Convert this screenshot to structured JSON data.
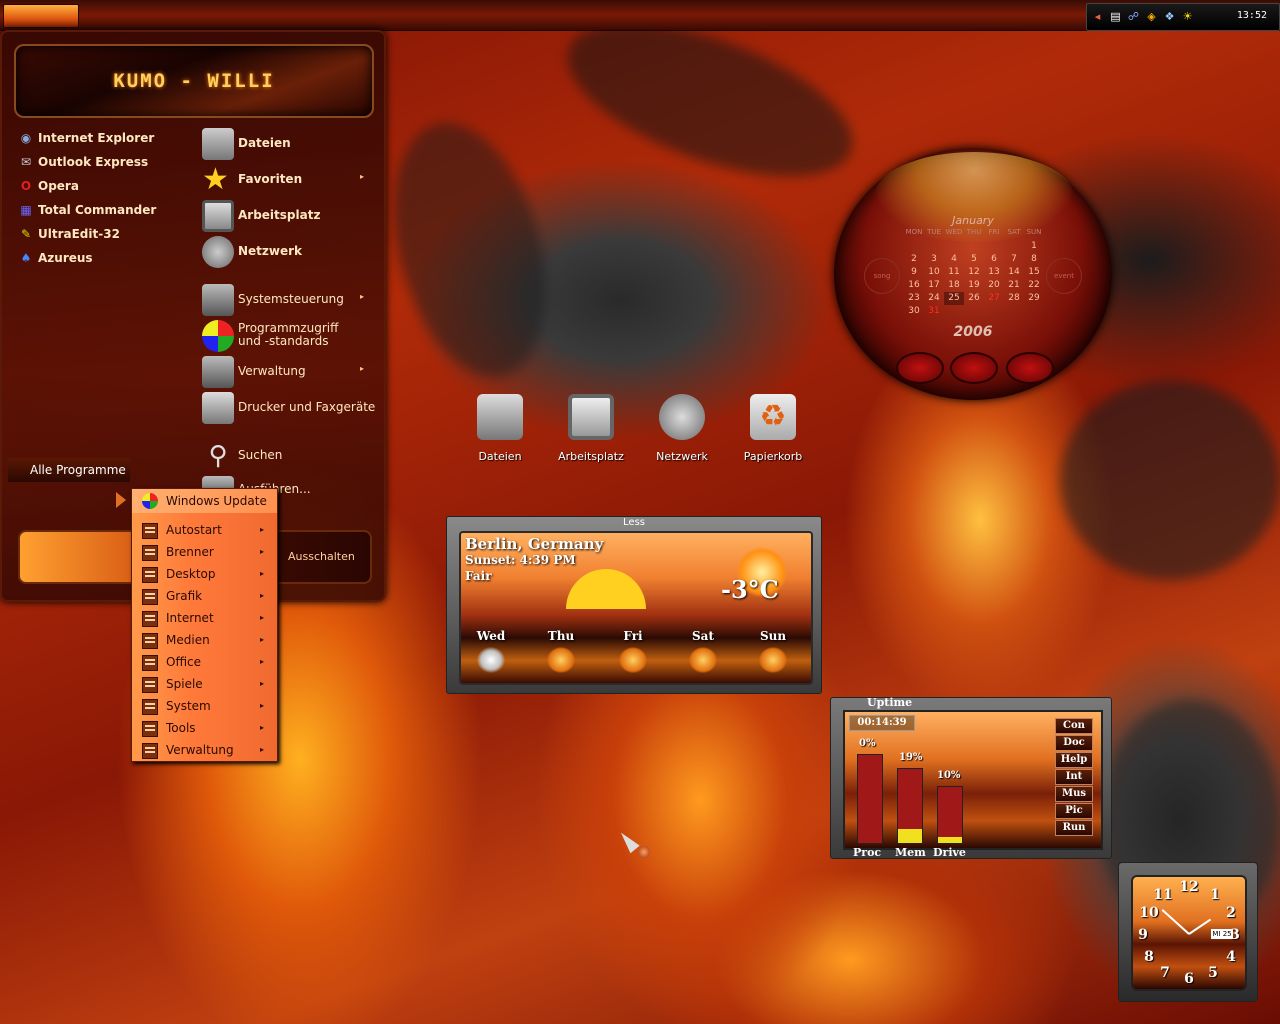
{
  "taskbar": {
    "clock": "13:52",
    "tray_icons": [
      "arrow-icon",
      "floppy-icon",
      "network-icon",
      "media-icon",
      "app-icon",
      "weather-icon"
    ]
  },
  "start_menu": {
    "user_name": "KUMO - WILLI",
    "pinned": [
      {
        "label": "Internet Explorer",
        "icon": "ie-icon"
      },
      {
        "label": "Outlook Express",
        "icon": "outlook-icon"
      },
      {
        "label": "Opera",
        "icon": "opera-icon"
      },
      {
        "label": "Total Commander",
        "icon": "totalcmd-icon"
      },
      {
        "label": "UltraEdit-32",
        "icon": "ultraedit-icon"
      },
      {
        "label": "Azureus",
        "icon": "azureus-icon"
      }
    ],
    "places": [
      {
        "label": "Dateien",
        "icon": "folder-icon"
      },
      {
        "label": "Favoriten",
        "icon": "star-icon",
        "arrow": "▸"
      },
      {
        "label": "Arbeitsplatz",
        "icon": "monitor-icon"
      },
      {
        "label": "Netzwerk",
        "icon": "network-icon"
      },
      {
        "label": "Systemsteuerung",
        "icon": "control-panel-icon",
        "arrow": "▸"
      },
      {
        "label": "Programmzugriff und -standards",
        "icon": "defaults-icon"
      },
      {
        "label": "Verwaltung",
        "icon": "admin-icon",
        "arrow": "▸"
      },
      {
        "label": "Drucker und Faxgeräte",
        "icon": "printer-icon"
      },
      {
        "label": "Suchen",
        "icon": "search-icon"
      },
      {
        "label": "Ausführen...",
        "icon": "run-icon"
      }
    ],
    "all_programs": "Alle Programme",
    "shutdown": "Ausschalten"
  },
  "submenu": {
    "top": "Windows Update",
    "items": [
      "Autostart",
      "Brenner",
      "Desktop",
      "Grafik",
      "Internet",
      "Medien",
      "Office",
      "Spiele",
      "System",
      "Tools",
      "Verwaltung"
    ]
  },
  "desktop_icons": [
    {
      "label": "Dateien",
      "icon": "folder-icon"
    },
    {
      "label": "Arbeitsplatz",
      "icon": "monitor-icon"
    },
    {
      "label": "Netzwerk",
      "icon": "network-icon"
    },
    {
      "label": "Papierkorb",
      "icon": "recycle-bin-icon"
    }
  ],
  "calendar": {
    "month": "January",
    "year": "2006",
    "dows": [
      "MON",
      "TUE",
      "WED",
      "THU",
      "FRI",
      "SAT",
      "SUN"
    ],
    "rows": [
      [
        "",
        "",
        "",
        "",
        "",
        "",
        "1"
      ],
      [
        "2",
        "3",
        "4",
        "5",
        "6",
        "7",
        "8"
      ],
      [
        "9",
        "10",
        "11",
        "12",
        "13",
        "14",
        "15"
      ],
      [
        "16",
        "17",
        "18",
        "19",
        "20",
        "21",
        "22"
      ],
      [
        "23",
        "24",
        "25",
        "26",
        "27",
        "28",
        "29"
      ],
      [
        "30",
        "31",
        "",
        "",
        "",
        "",
        ""
      ]
    ],
    "left_label": "song",
    "right_label": "event"
  },
  "weather": {
    "toggle": "Less",
    "city": "Berlin, Germany",
    "sunset": "Sunset: 4:39 PM",
    "condition": "Fair",
    "temp": "-3°C",
    "forecast": [
      "Wed",
      "Thu",
      "Fri",
      "Sat",
      "Sun"
    ]
  },
  "uptime": {
    "title": "Uptime",
    "time": "00:14:39",
    "bars": [
      {
        "label": "Proc",
        "pct": "0%",
        "value": 0
      },
      {
        "label": "Mem",
        "pct": "19%",
        "value": 19
      },
      {
        "label": "Drive",
        "pct": "10%",
        "value": 10
      }
    ],
    "buttons": [
      "Con",
      "Doc",
      "Help",
      "Int",
      "Mus",
      "Pic",
      "Run"
    ]
  },
  "clock": {
    "numbers": [
      "12",
      "1",
      "2",
      "3",
      "4",
      "5",
      "6",
      "7",
      "8",
      "9",
      "10",
      "11"
    ],
    "date": "MI 25",
    "time": "13:52"
  },
  "colors": {
    "accent": "#e05a10",
    "highlight": "#ffd060"
  }
}
